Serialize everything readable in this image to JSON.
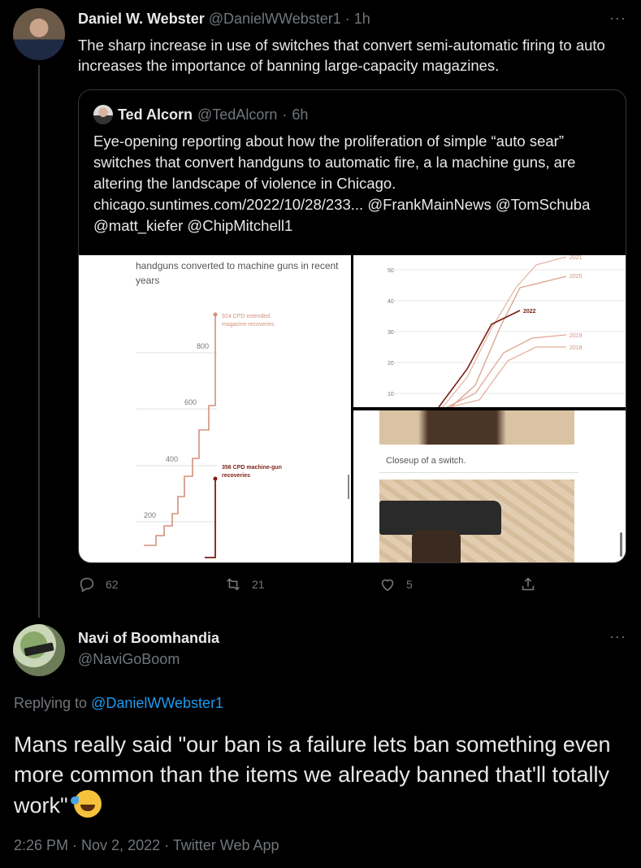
{
  "tweet1": {
    "author_name": "Daniel W. Webster",
    "handle": "@DanielWWebster1",
    "separator": "·",
    "time": "1h",
    "more_icon": "more-horizontal-icon",
    "text": "The sharp increase in use of switches that convert semi-automatic firing to auto increases the importance of banning large-capacity magazines.",
    "quote": {
      "author_name": "Ted Alcorn",
      "handle": "@TedAlcorn",
      "separator": "·",
      "time": "6h",
      "text": "Eye-opening reporting about how the proliferation of simple “auto sear” switches that convert handguns to automatic fire, a la machine guns, are altering the landscape of violence in Chicago.",
      "link": "chicago.suntimes.com/2022/10/28/233...",
      "mentions": "@FrankMainNews @TomSchuba @matt_kiefer @ChipMitchell1",
      "media1": {
        "caption": "handguns converted to machine guns in recent years",
        "tick_800": "800",
        "tick_600": "600",
        "tick_400": "400",
        "tick_200": "200",
        "label_extended": "924 CPD extended",
        "label_extended2": "magazine recoveries",
        "label_mg": "356 CPD machine-gun",
        "label_mg2": "recoveries"
      },
      "media2": {
        "ticks": [
          "50",
          "40",
          "30",
          "20",
          "10"
        ],
        "labels": [
          "2021",
          "2020",
          "2022",
          "2019",
          "2018"
        ]
      },
      "media3": {
        "caption": "Closeup of a switch."
      }
    },
    "actions": {
      "reply_count": "62",
      "retweet_count": "21",
      "like_count": "5"
    }
  },
  "tweet2": {
    "author_name": "Navi of Boomhandia",
    "handle": "@NaviGoBoom",
    "replying_prefix": "Replying to",
    "replying_to": "@DanielWWebster1",
    "text": "Mans really said \"our ban is a failure lets ban something even more common than the items we already banned that'll totally work\"",
    "emoji_icon": "rolling-on-floor-laughing-icon",
    "meta": "2:26 PM · Nov 2, 2022 · Twitter Web App"
  }
}
